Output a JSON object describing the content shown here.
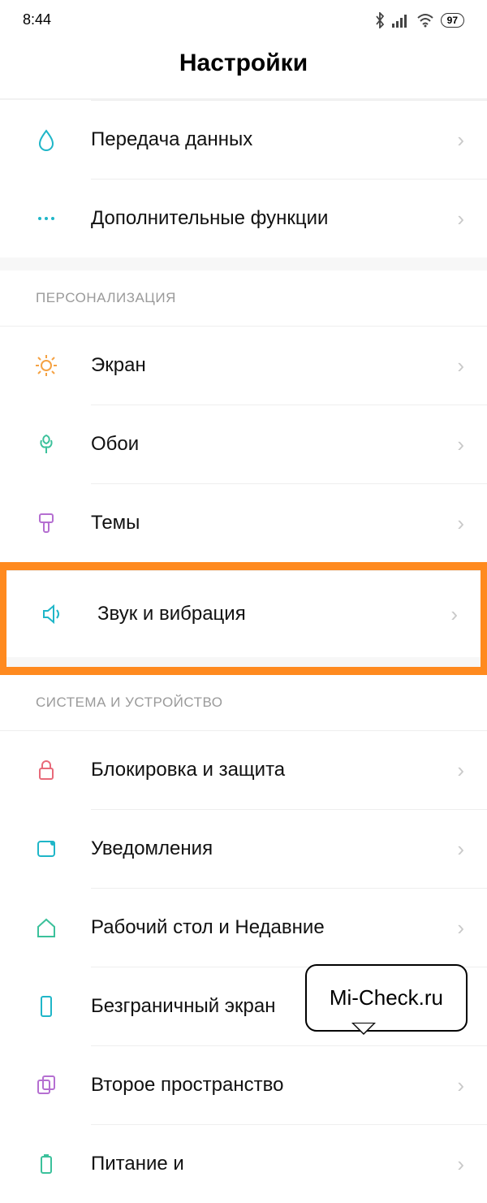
{
  "status": {
    "time": "8:44",
    "battery": "97"
  },
  "header": {
    "title": "Настройки"
  },
  "rows": {
    "data_transfer": "Передача данных",
    "more_features": "Дополнительные функции"
  },
  "sections": {
    "personalization": {
      "title": "ПЕРСОНАЛИЗАЦИЯ",
      "items": {
        "screen": "Экран",
        "wallpaper": "Обои",
        "themes": "Темы",
        "sound": "Звук и вибрация"
      }
    },
    "system": {
      "title": "СИСТЕМА И УСТРОЙСТВО",
      "items": {
        "lock": "Блокировка и защита",
        "notifications": "Уведомления",
        "home": "Рабочий стол и Недавние",
        "fullscreen": "Безграничный экран",
        "second_space": "Второе пространство",
        "power": "Питание и"
      }
    }
  },
  "watermark": "Mi-Check.ru"
}
